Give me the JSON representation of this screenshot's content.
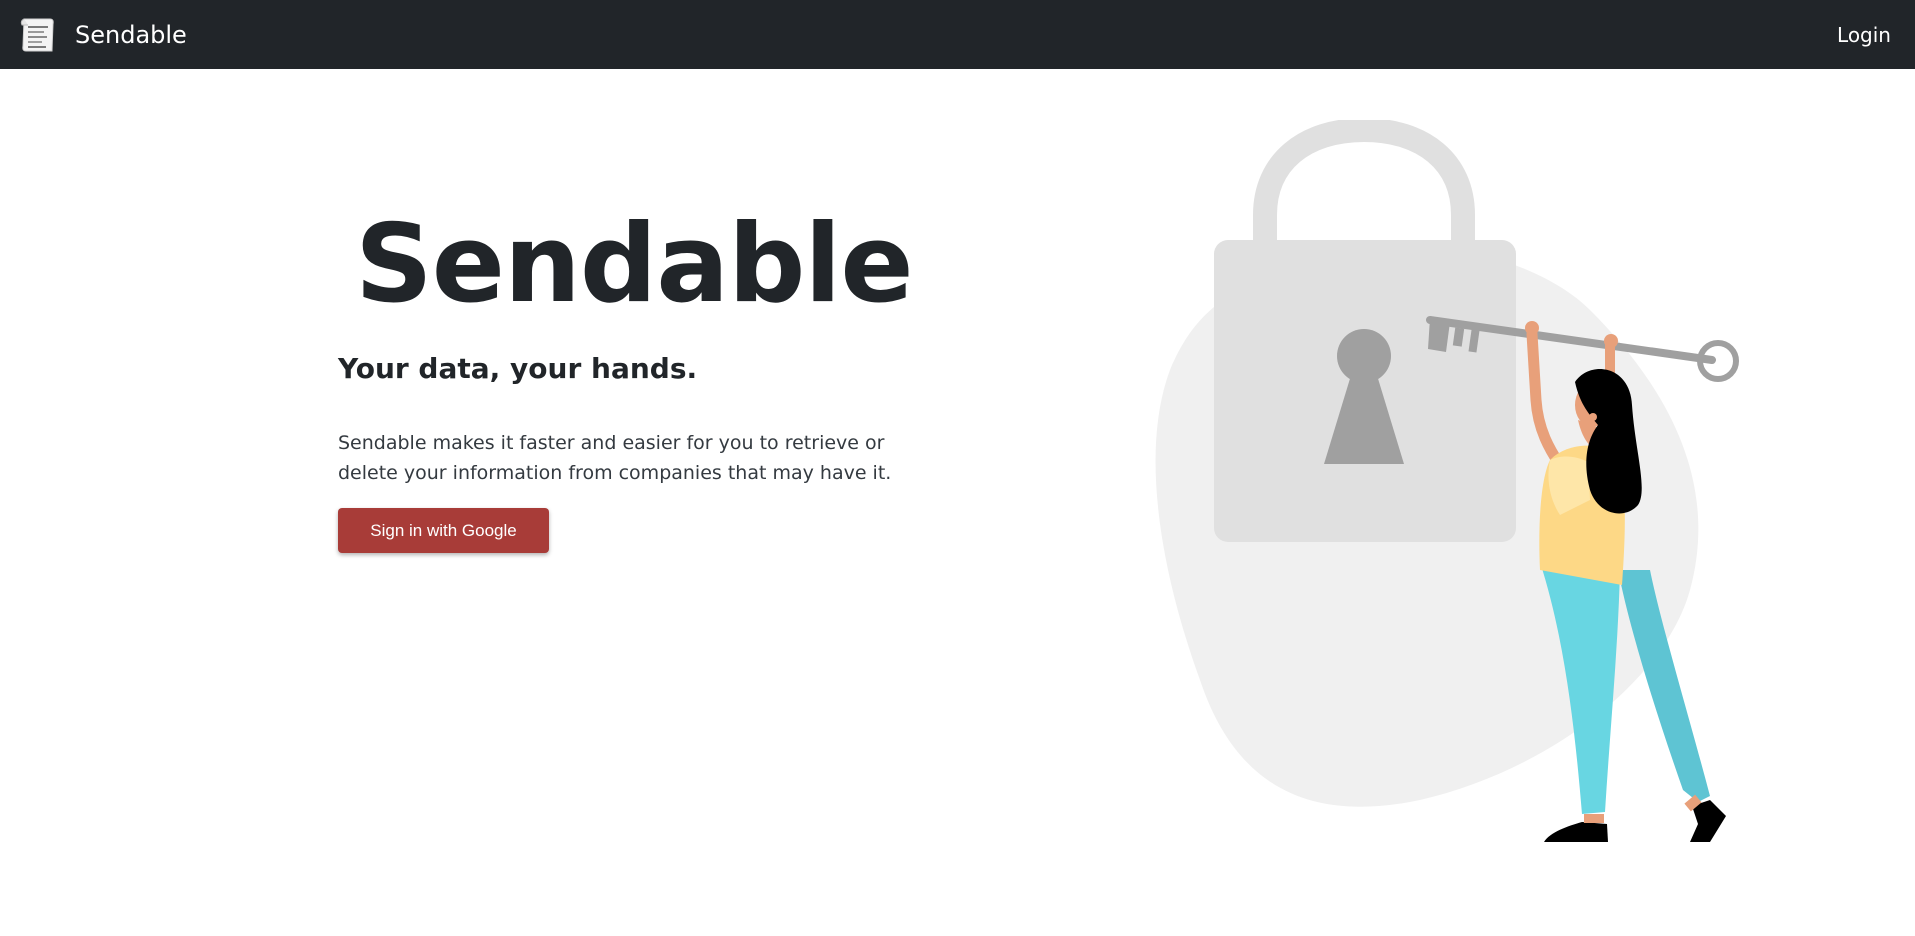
{
  "navbar": {
    "brand": "Sendable",
    "login": "Login"
  },
  "hero": {
    "title": "Sendable",
    "subtitle": "Your data, your hands.",
    "description": "Sendable makes it faster and easier for you to retrieve or delete your information from companies that may have it.",
    "button": "Sign in with Google"
  },
  "colors": {
    "navbar": "#212529",
    "button": "#a83c38",
    "blob": "#f0f0f0",
    "lock": "#e0e0e0",
    "key": "#a0a0a0",
    "shirt": "#fdd886",
    "pants": "#68d6e2",
    "skin": "#e8a07a"
  },
  "icons": {
    "brand": "sendable-logo-icon"
  }
}
